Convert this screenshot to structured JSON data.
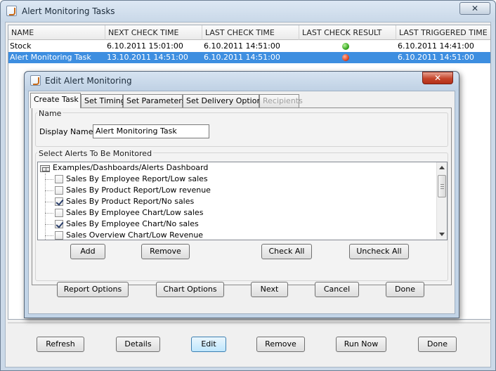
{
  "main_window": {
    "title": "Alert Monitoring Tasks",
    "close_label": "✕",
    "table": {
      "columns": [
        "NAME",
        "NEXT CHECK TIME",
        "LAST CHECK TIME",
        "LAST CHECK RESULT",
        "LAST TRIGGERED TIME"
      ],
      "rows": [
        {
          "name": "Stock",
          "next_check": "6.10.2011 15:01:00",
          "last_check": "6.10.2011 14:51:00",
          "result": "green-status-icon",
          "last_triggered": "6.10.2011 14:41:00",
          "selected": false
        },
        {
          "name": "Alert Monitoring Task",
          "next_check": "13.10.2011 14:51:00",
          "last_check": "6.10.2011 14:51:00",
          "result": "red-status-icon",
          "last_triggered": "6.10.2011 14:51:00",
          "selected": true
        }
      ]
    },
    "buttons": {
      "refresh": "Refresh",
      "details": "Details",
      "edit": "Edit",
      "remove": "Remove",
      "run_now": "Run Now",
      "done": "Done"
    }
  },
  "dialog": {
    "title": "Edit Alert Monitoring",
    "close_label": "✕",
    "tabs": [
      {
        "label": "Create Task",
        "active": true,
        "enabled": true
      },
      {
        "label": "Set Timing",
        "active": false,
        "enabled": true
      },
      {
        "label": "Set Parameters",
        "active": false,
        "enabled": true
      },
      {
        "label": "Set Delivery Options",
        "active": false,
        "enabled": true
      },
      {
        "label": "Recipients",
        "active": false,
        "enabled": false
      }
    ],
    "name_group": {
      "title": "Name",
      "display_name_label": "Display Name:",
      "display_name_value": "Alert Monitoring Task"
    },
    "alerts_group": {
      "title": "Select Alerts To Be Monitored",
      "root": "Examples/Dashboards/Alerts Dashboard",
      "items": [
        {
          "label": "Sales By Employee Report/Low sales",
          "checked": false
        },
        {
          "label": "Sales By Product Report/Low revenue",
          "checked": false
        },
        {
          "label": "Sales By Product Report/No sales",
          "checked": true
        },
        {
          "label": "Sales By Employee Chart/Low sales",
          "checked": false
        },
        {
          "label": "Sales By Employee Chart/No sales",
          "checked": true
        },
        {
          "label": "Sales Overview Chart/Low Revenue",
          "checked": false
        }
      ],
      "buttons": {
        "add": "Add",
        "remove": "Remove",
        "check_all": "Check All",
        "uncheck_all": "Uncheck All"
      }
    },
    "buttons": {
      "report_options": "Report Options",
      "chart_options": "Chart Options",
      "next": "Next",
      "cancel": "Cancel",
      "done": "Done"
    }
  },
  "colors": {
    "selection": "#3d8ee0",
    "window_frame": "#cbd9e8",
    "close_red": "#c5452b"
  }
}
